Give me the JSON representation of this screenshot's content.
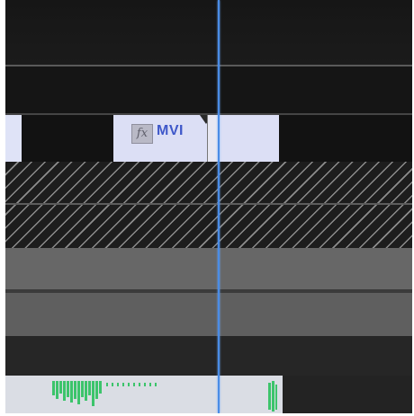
{
  "timeline": {
    "video_clip": {
      "fx_badge": "fx",
      "label": "MVI"
    },
    "playhead": {
      "color": "#4a8ce6"
    }
  },
  "colors": {
    "clip_fill": "#dcdff5",
    "clip_label": "#3f58c9",
    "audio_waveform": "#3cc46b",
    "track_bg": "#171717"
  },
  "icons": [
    "fx-icon",
    "in-point-notch-icon"
  ]
}
